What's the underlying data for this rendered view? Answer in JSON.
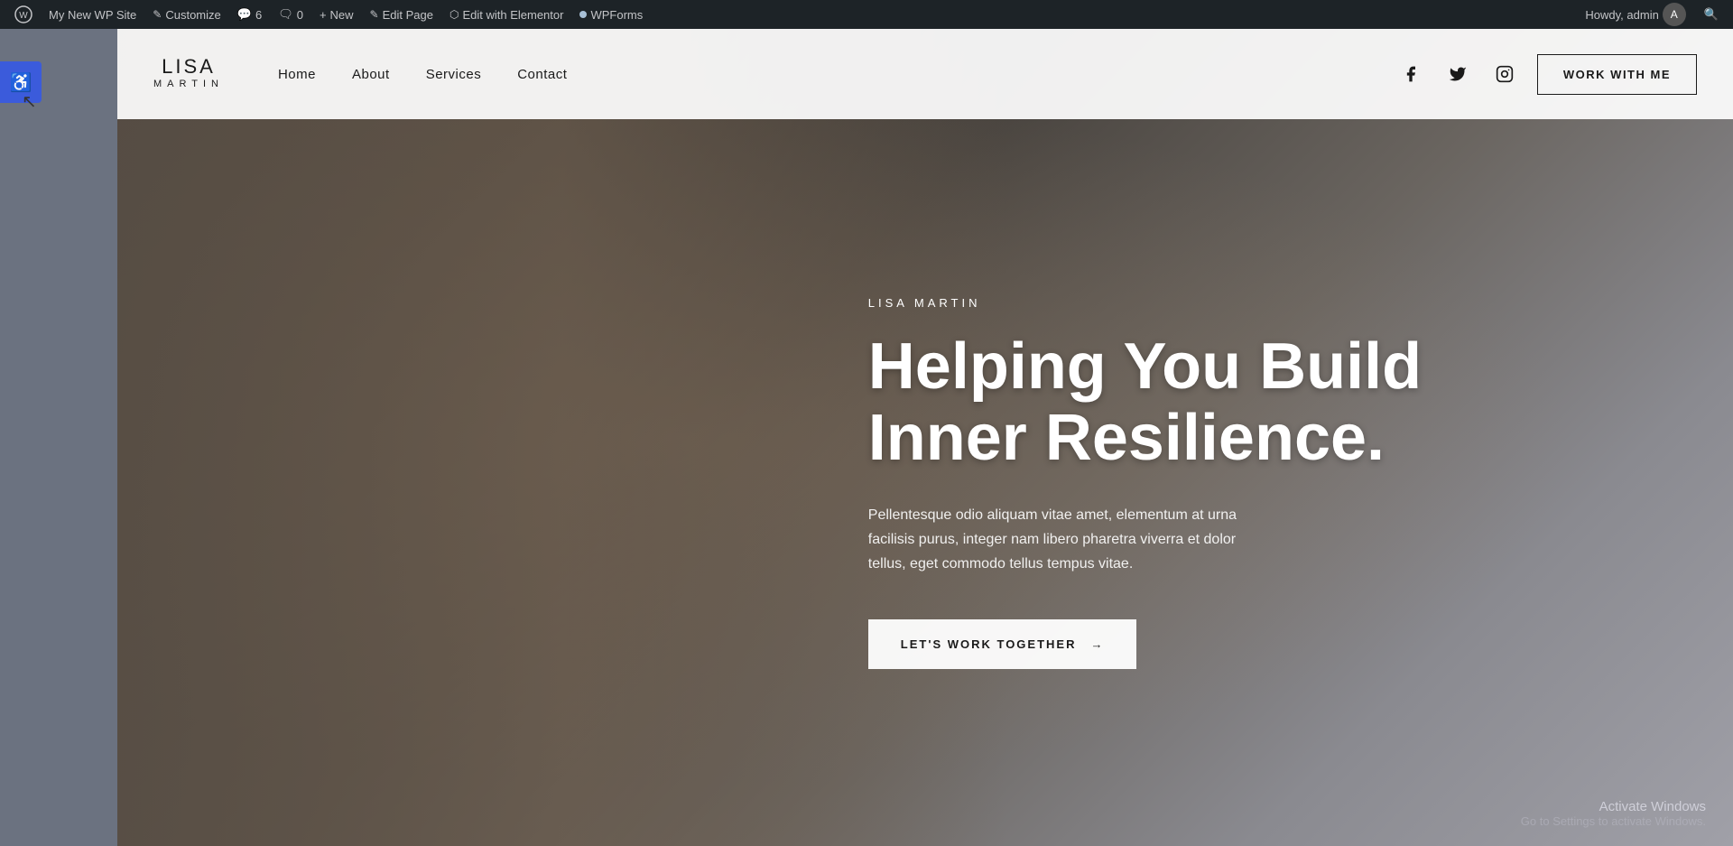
{
  "adminbar": {
    "site_name": "My New WP Site",
    "customize": "Customize",
    "comments_count": "6",
    "messages_count": "0",
    "new_label": "New",
    "edit_page_label": "Edit Page",
    "edit_with_elementor": "Edit with Elementor",
    "wpforms": "WPForms",
    "howdy": "Howdy, admin"
  },
  "navbar": {
    "logo_first": "LISA",
    "logo_last": "MARTIN",
    "nav_home": "Home",
    "nav_about": "About",
    "nav_services": "Services",
    "nav_contact": "Contact",
    "work_with_me": "WORK WITH ME"
  },
  "hero": {
    "name": "LISA MARTIN",
    "headline_line1": "Helping You Build",
    "headline_line2": "Inner Resilience.",
    "description": "Pellentesque odio aliquam vitae amet, elementum at urna facilisis purus, integer nam libero pharetra viverra et dolor tellus, eget commodo tellus tempus vitae.",
    "cta_label": "LET'S WORK TOGETHER",
    "cta_arrow": "→"
  },
  "activate_windows": {
    "title": "Activate Windows",
    "subtitle": "Go to Settings to activate Windows."
  },
  "icons": {
    "wp_logo": "⊕",
    "facebook": "f",
    "twitter": "𝕏",
    "instagram": "◎",
    "accessibility": "♿",
    "new_icon": "+",
    "edit_icon": "✎",
    "elementor_icon": "⬡",
    "comments_icon": "💬",
    "search_icon": "🔍",
    "user_icon": "👤"
  }
}
